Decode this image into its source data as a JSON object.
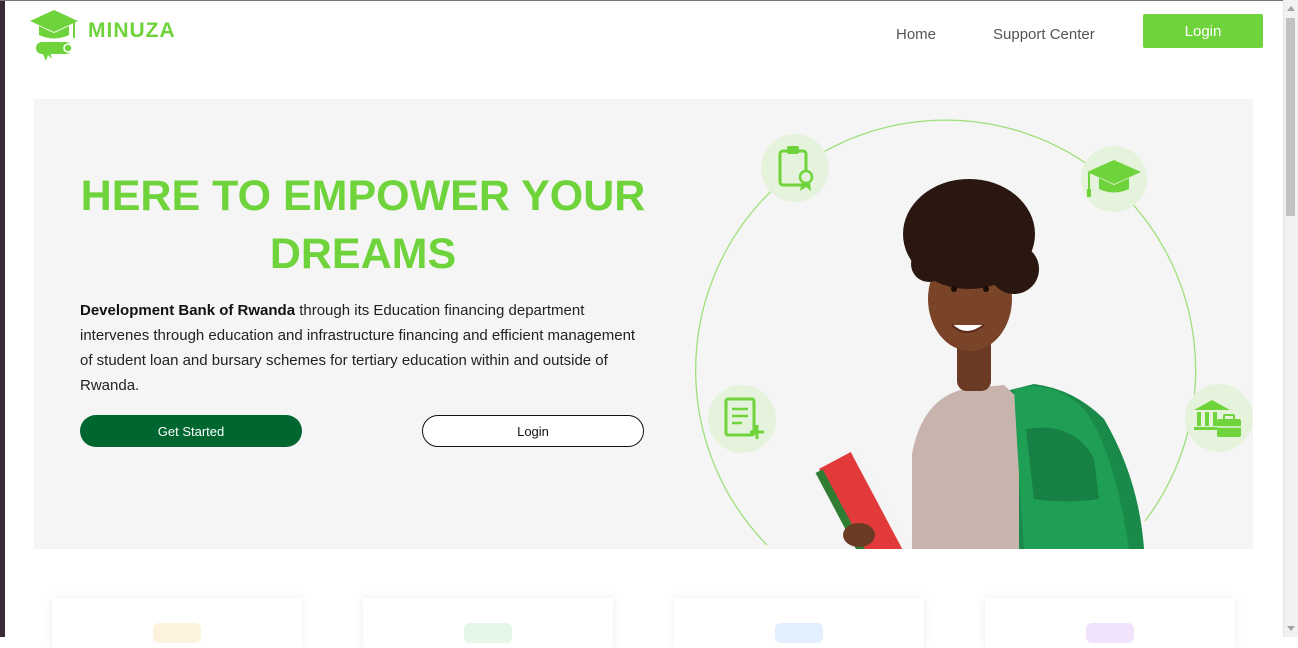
{
  "header": {
    "brand": "MINUZA",
    "nav": {
      "home": "Home",
      "support": "Support Center"
    },
    "login_label": "Login"
  },
  "hero": {
    "headline": "HERE TO EMPOWER YOUR DREAMS",
    "intro_bold": "Development Bank of Rwanda",
    "intro_rest": " through its Education financing department intervenes through education and infrastructure financing and efficient management of student loan and bursary schemes for tertiary education within and outside of Rwanda.",
    "get_started_label": "Get Started",
    "login_label": "Login"
  },
  "icons": [
    "graduation-cap-logo-icon",
    "clipboard-certificate-icon",
    "mortarboard-icon",
    "document-add-icon",
    "bank-briefcase-icon"
  ],
  "colors": {
    "brand_green": "#6fd33b",
    "dark_green": "#006630",
    "hero_bg": "#f5f5f5",
    "card_icon_tints": [
      "#fdf3dc",
      "#e3f6e8",
      "#e2efff",
      "#f0e3fb"
    ]
  }
}
